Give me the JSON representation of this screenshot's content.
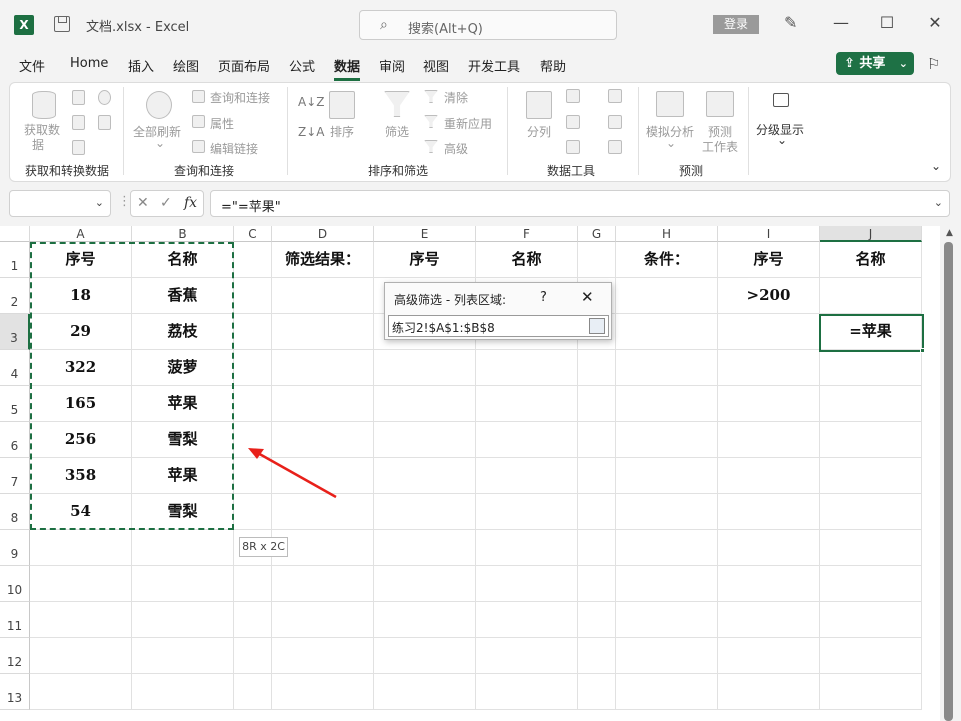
{
  "titlebar": {
    "app_icon": "excel-logo-icon",
    "app_letter": "X",
    "doc_title": "文档.xlsx  -  Excel",
    "search_placeholder": "搜索(Alt+Q)",
    "login_label": "登录",
    "minimize_glyph": "—",
    "maximize_glyph": "☐",
    "close_glyph": "✕"
  },
  "menu": {
    "tabs": [
      "文件",
      "Home",
      "插入",
      "绘图",
      "页面布局",
      "公式",
      "数据",
      "审阅",
      "视图",
      "开发工具",
      "帮助"
    ],
    "active_tab": "数据",
    "share_label": "共享",
    "share_chevron": "⌄"
  },
  "ribbon": {
    "groups": [
      {
        "label": "获取和转换数据",
        "items": [
          "获取数",
          "据"
        ]
      },
      {
        "label": "查询和连接",
        "items": [
          "全部刷新",
          "查询和连接",
          "属性",
          "编辑链接"
        ]
      },
      {
        "label": "排序和筛选",
        "items": [
          "排序",
          "筛选",
          "清除",
          "重新应用",
          "高级"
        ]
      },
      {
        "label": "数据工具",
        "items": [
          "分列"
        ]
      },
      {
        "label": "预测",
        "items": [
          "模拟分析",
          "预测",
          "工作表"
        ]
      },
      {
        "label": "",
        "items": [
          "分级显示"
        ]
      }
    ],
    "sort_az": "A↓Z",
    "sort_za": "Z↓A",
    "collapse_glyph": "⌄"
  },
  "formula_bar": {
    "name_box": "",
    "cancel_glyph": "✕",
    "enter_glyph": "✓",
    "fx_glyph": "fx",
    "formula": "=\"=苹果\""
  },
  "sheet": {
    "columns": [
      "A",
      "B",
      "C",
      "D",
      "E",
      "F",
      "G",
      "H",
      "I",
      "J"
    ],
    "rows": [
      "1",
      "2",
      "3",
      "4",
      "5",
      "6",
      "7",
      "8",
      "9",
      "10",
      "11",
      "12",
      "13"
    ],
    "cells": {
      "A1": "序号",
      "B1": "名称",
      "A2": "18",
      "B2": "香蕉",
      "A3": "29",
      "B3": "荔枝",
      "A4": "322",
      "B4": "菠萝",
      "A5": "165",
      "B5": "苹果",
      "A6": "256",
      "B6": "雪梨",
      "A7": "358",
      "B7": "苹果",
      "A8": "54",
      "B8": "雪梨",
      "D1": "筛选结果：",
      "E1": "序号",
      "F1": "名称",
      "H1": "条件：",
      "I1": "序号",
      "J1": "名称",
      "I2": ">200",
      "J3": "=苹果"
    },
    "selection_tooltip": "8R x 2C",
    "active_cell": "J3"
  },
  "dialog": {
    "title": "高级筛选 - 列表区域:",
    "help_glyph": "?",
    "close_glyph": "✕",
    "range_value": "练习2!$A$1:$B$8"
  },
  "colors": {
    "excel_green": "#1d6f42",
    "arrow_red": "#e8201a"
  }
}
